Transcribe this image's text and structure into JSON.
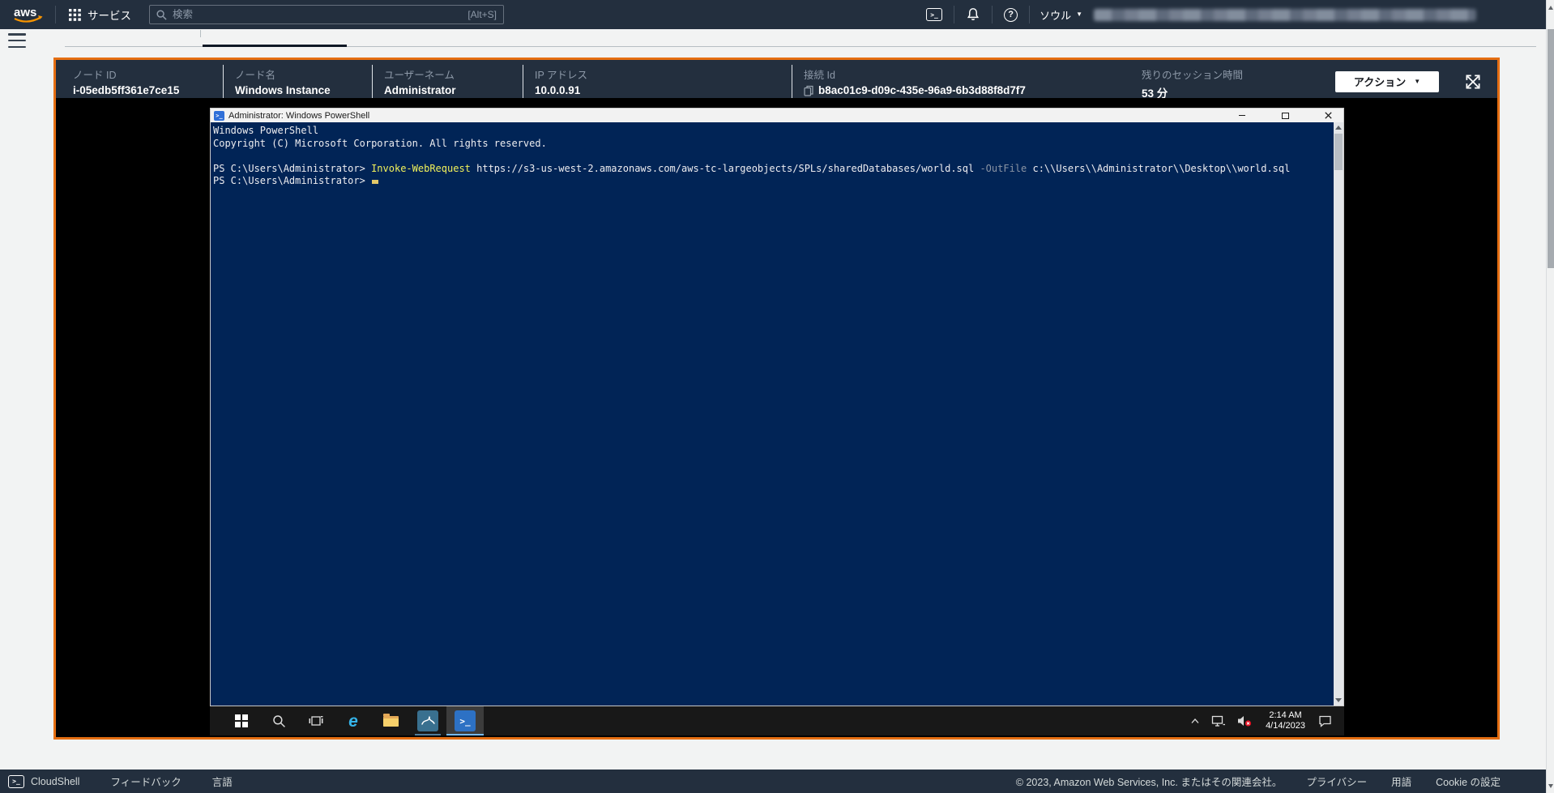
{
  "topnav": {
    "logo_text": "aws",
    "services": "サービス",
    "search_placeholder": "検索",
    "search_shortcut": "[Alt+S]",
    "region": "ソウル"
  },
  "icons": {
    "terminal_glyph": ">_",
    "help_glyph": "?",
    "caret_down": "▼",
    "ie_glyph": "e",
    "powershell_glyph": ">_"
  },
  "session": {
    "fields": [
      {
        "label": "ノード ID",
        "value": "i-05edb5ff361e7ce15"
      },
      {
        "label": "ノード名",
        "value": "Windows Instance"
      },
      {
        "label": "ユーザーネーム",
        "value": "Administrator"
      },
      {
        "label": "IP アドレス",
        "value": "10.0.0.91"
      },
      {
        "label": "接続 Id",
        "value": "b8ac01c9-d09c-435e-96a9-6b3d88f8d7f7"
      },
      {
        "label": "残りのセッション時間",
        "value": "53 分"
      }
    ],
    "action_button": "アクション"
  },
  "remote_desktop": {
    "window_title": "Administrator: Windows PowerShell",
    "console": {
      "banner_line1": "Windows PowerShell",
      "banner_line2": "Copyright (C) Microsoft Corporation. All rights reserved.",
      "prompt": "PS C:\\Users\\Administrator> ",
      "command": "Invoke-WebRequest",
      "url": " https://s3-us-west-2.amazonaws.com/aws-tc-largeobjects/SPLs/sharedDatabases/world.sql ",
      "parameter": "-OutFile",
      "output_path": " c:\\\\Users\\\\Administrator\\\\Desktop\\\\world.sql"
    },
    "taskbar": {
      "time": "2:14 AM",
      "date": "4/14/2023"
    }
  },
  "footer": {
    "cloudshell": "CloudShell",
    "feedback": "フィードバック",
    "language": "言語",
    "copyright": "© 2023, Amazon Web Services, Inc. またはその関連会社。",
    "privacy": "プライバシー",
    "terms": "用語",
    "cookie_settings": "Cookie の設定"
  },
  "colors": {
    "accent_orange": "#e56e12",
    "navbar_bg": "#232f3e",
    "console_bg": "#012456",
    "command_yellow": "#f2f25a",
    "parameter_gray": "#8a94a4",
    "taskbar_active_underline": "#76b9ed"
  }
}
